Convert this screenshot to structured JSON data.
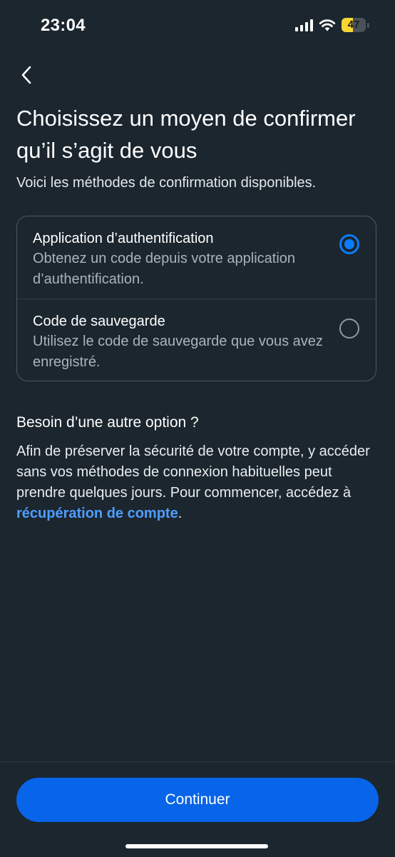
{
  "status_bar": {
    "time": "23:04",
    "battery_level": "47",
    "battery_fraction": 0.47,
    "icons": [
      "cellular-signal-icon",
      "wifi-icon",
      "battery-icon"
    ],
    "battery_color": "#f6d532"
  },
  "header": {
    "back_icon": "chevron-left-icon",
    "title": "Choisissez un moyen de confirmer qu’il s’agit de vous",
    "subtitle": "Voici les méthodes de confirmation disponibles."
  },
  "options": [
    {
      "title": "Application d’authentification",
      "description": "Obtenez un code depuis votre application d’authentification.",
      "selected": true
    },
    {
      "title": "Code de sauvegarde",
      "description": "Utilisez le code de sauvegarde que vous avez enregistré.",
      "selected": false
    }
  ],
  "help": {
    "title": "Besoin d’une autre option ?",
    "text": "Afin de préserver la sécurité de votre compte, y accéder sans vos méthodes de connexion habituelles peut prendre quelques jours. Pour commencer, accédez à ",
    "link_label": "récupération de compte",
    "text_end": "."
  },
  "footer": {
    "continue_label": "Continuer"
  },
  "colors": {
    "background": "#1b262e",
    "accent": "#0a7cff",
    "button": "#0864e8",
    "link": "#4f9dff"
  }
}
